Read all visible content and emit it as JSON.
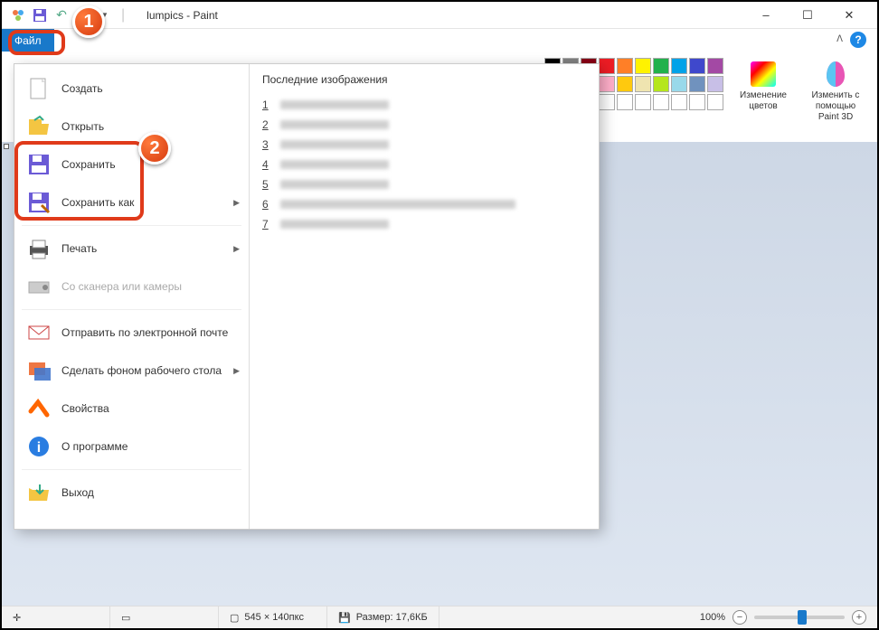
{
  "window": {
    "title": "lumpics - Paint",
    "minimize": "–",
    "maximize": "☐",
    "close": "✕"
  },
  "ribbon": {
    "file_tab": "Файл",
    "help": "?",
    "edit_colors": "Изменение цветов",
    "paint3d_line1": "Изменить с",
    "paint3d_line2": "помощью Paint 3D",
    "colors_row1": [
      "#000000",
      "#7f7f7f",
      "#880015",
      "#ed1c24",
      "#ff7f27",
      "#fff200",
      "#22b14c",
      "#00a2e8",
      "#3f48cc",
      "#a349a4"
    ],
    "colors_row2": [
      "#ffffff",
      "#c3c3c3",
      "#b97a57",
      "#ffaec9",
      "#ffc90e",
      "#efe4b0",
      "#b5e61d",
      "#99d9ea",
      "#7092be",
      "#c8bfe7"
    ],
    "colors_row3": [
      "#ffffff",
      "#ffffff",
      "#ffffff",
      "#ffffff",
      "#ffffff",
      "#ffffff",
      "#ffffff",
      "#ffffff",
      "#ffffff",
      "#ffffff"
    ]
  },
  "file_menu": {
    "items": [
      {
        "label": "Создать",
        "icon": "new",
        "arrow": false,
        "disabled": false
      },
      {
        "label": "Открыть",
        "icon": "open",
        "arrow": false,
        "disabled": false
      },
      {
        "label": "Сохранить",
        "icon": "save",
        "arrow": false,
        "disabled": false
      },
      {
        "label": "Сохранить как",
        "icon": "saveas",
        "arrow": true,
        "disabled": false
      },
      {
        "label": "Печать",
        "icon": "print",
        "arrow": true,
        "disabled": false
      },
      {
        "label": "Со сканера или камеры",
        "icon": "scanner",
        "arrow": false,
        "disabled": true
      },
      {
        "label": "Отправить по электронной почте",
        "icon": "email",
        "arrow": false,
        "disabled": false
      },
      {
        "label": "Сделать фоном рабочего стола",
        "icon": "desktop",
        "arrow": true,
        "disabled": false
      },
      {
        "label": "Свойства",
        "icon": "props",
        "arrow": false,
        "disabled": false
      },
      {
        "label": "О программе",
        "icon": "about",
        "arrow": false,
        "disabled": false
      },
      {
        "label": "Выход",
        "icon": "exit",
        "arrow": false,
        "disabled": false
      }
    ],
    "recent_title": "Последние изображения",
    "recent_indices": [
      "1",
      "2",
      "3",
      "4",
      "5",
      "6",
      "7"
    ]
  },
  "statusbar": {
    "dims": "545 × 140пкс",
    "size_label": "Размер: 17,6КБ",
    "zoom": "100%"
  },
  "annotations": {
    "badge1": "1",
    "badge2": "2"
  }
}
